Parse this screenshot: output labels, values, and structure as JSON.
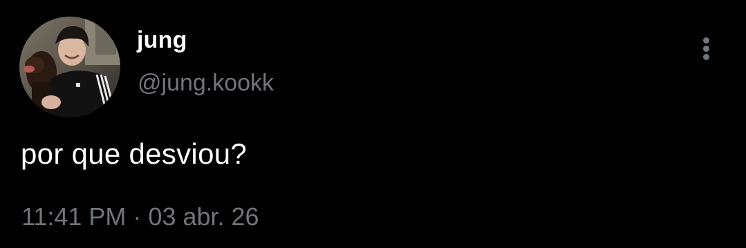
{
  "tweet": {
    "author": {
      "display_name": "jung",
      "handle": "@jung.kookk",
      "avatar_icon": "profile-photo"
    },
    "text": "por que desviou?",
    "time": "11:41 PM",
    "separator": "·",
    "date": "03 abr. 26",
    "more_icon": "more-vertical-icon"
  },
  "colors": {
    "background": "#000000",
    "primary_text": "#ffffff",
    "secondary_text": "#71767b"
  }
}
